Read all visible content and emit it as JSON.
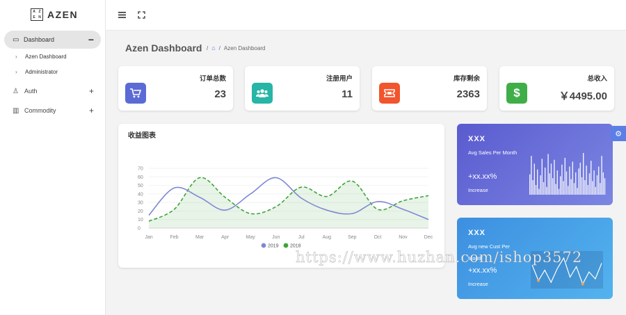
{
  "app": {
    "logo_letters": [
      "A",
      "Z",
      "E",
      "N"
    ],
    "logo_text": "AZEN"
  },
  "sidebar": {
    "active": {
      "label": "Dashboard",
      "toggle": "−"
    },
    "subitems": [
      {
        "label": "Azen Dashboard"
      },
      {
        "label": "Administrator"
      }
    ],
    "items": [
      {
        "label": "Auth",
        "toggle": "+"
      },
      {
        "label": "Commodity",
        "toggle": "+"
      }
    ]
  },
  "topbar": {
    "menu_icon": "hamburger-icon",
    "fullscreen_icon": "fullscreen-icon"
  },
  "page": {
    "title": "Azen Dashboard",
    "breadcrumb_sep": "/",
    "breadcrumb_current": "Azen Dashboard"
  },
  "stats": [
    {
      "title": "订单总数",
      "value": "23",
      "icon": "cart-icon",
      "color": "#5b6bd6"
    },
    {
      "title": "注册用户",
      "value": "11",
      "icon": "users-icon",
      "color": "#26b5a6"
    },
    {
      "title": "库存剩余",
      "value": "2363",
      "icon": "ticket-icon",
      "color": "#f2542d"
    },
    {
      "title": "总收入",
      "value": "￥4495.00",
      "icon": "dollar-icon",
      "color": "#3fae49"
    }
  ],
  "revenue": {
    "title": "收益图表",
    "colors": {
      "2019": "#7f88d6",
      "2018": "#3fa33a"
    }
  },
  "chart_data": {
    "type": "line",
    "title": "收益图表",
    "x": [
      "Jan",
      "Feb",
      "Mar",
      "Apr",
      "May",
      "Jun",
      "Jul",
      "Aug",
      "Sep",
      "Oct",
      "Nov",
      "Dec"
    ],
    "ylim": [
      0,
      70
    ],
    "yticks": [
      0,
      10,
      20,
      30,
      40,
      50,
      60,
      70
    ],
    "grid": true,
    "legend": "bottom",
    "series": [
      {
        "name": "2019",
        "values": [
          15,
          47,
          36,
          21,
          40,
          59,
          35,
          21,
          17,
          31,
          22,
          10
        ]
      },
      {
        "name": "2018",
        "values": [
          8,
          22,
          59,
          36,
          17,
          25,
          48,
          37,
          55,
          22,
          32,
          38
        ]
      }
    ]
  },
  "side_cards": [
    {
      "head": "XXX",
      "sub": "Avg Sales Per Month",
      "pct": "+xx.xx%",
      "inc": "Increase"
    },
    {
      "head": "XXX",
      "sub": "Avg new Cust Per Month",
      "pct": "+xx.xx%",
      "inc": "Increase"
    }
  ],
  "spark_bars": [
    42,
    80,
    30,
    64,
    20,
    52,
    12,
    40,
    74,
    26,
    56,
    16,
    84,
    44,
    64,
    34,
    72,
    22,
    50,
    12,
    38,
    62,
    28,
    76,
    48,
    18,
    58,
    32,
    68,
    24,
    46,
    14,
    54,
    66,
    36,
    86,
    30,
    60,
    20,
    44,
    70,
    28,
    50,
    16,
    40,
    58,
    24,
    80,
    46,
    34
  ],
  "spark_line": [
    60,
    15,
    45,
    10,
    50,
    80,
    25,
    55,
    5,
    40,
    20,
    65
  ],
  "watermark": "https://www.huzhan.com/ishop3572"
}
